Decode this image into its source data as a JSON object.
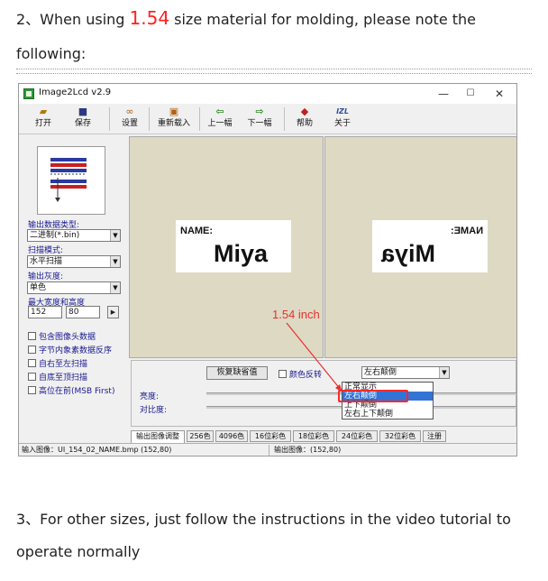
{
  "doc": {
    "line1_prefix": "2、When using ",
    "line1_highlight": "1.54",
    "line1_suffix": " size material for molding, please note the",
    "line2": "following:",
    "line3": "3、For other sizes, just follow the instructions in the video tutorial to",
    "line4": "operate normally"
  },
  "window": {
    "title": "Image2Lcd v2.9",
    "controls": {
      "minimize": "—",
      "maximize": "☐",
      "close": "✕"
    }
  },
  "toolbar": {
    "items": [
      {
        "label": "打开",
        "icon": "open-folder-icon",
        "glyph": "📂"
      },
      {
        "label": "保存",
        "icon": "save-disk-icon",
        "glyph": "💾"
      },
      {
        "label": "设置",
        "icon": "glasses-settings-icon",
        "glyph": "👓"
      },
      {
        "label": "重新载入",
        "icon": "reload-icon",
        "glyph": "🔄"
      },
      {
        "label": "上一幅",
        "icon": "arrow-left-icon",
        "glyph": "⬅"
      },
      {
        "label": "下一幅",
        "icon": "arrow-right-icon",
        "glyph": "➡"
      },
      {
        "label": "帮助",
        "icon": "help-icon",
        "glyph": "◆"
      },
      {
        "label": "关于",
        "icon": "about-logo-icon",
        "glyph": "IZL"
      }
    ]
  },
  "left": {
    "output_type_label": "输出数据类型:",
    "output_type_value": "二进制(*.bin)",
    "scan_mode_label": "扫描模式:",
    "scan_mode_value": "水平扫描",
    "gray_label": "输出灰度:",
    "gray_value": "单色",
    "max_size_label": "最大宽度和高度",
    "max_width": "152",
    "max_height": "80",
    "checkboxes": [
      "包含图像头数据",
      "字节内象素数据反序",
      "自右至左扫描",
      "自底至顶扫描",
      "高位在前(MSB First)"
    ]
  },
  "canvas": {
    "left_small": "NAME:",
    "left_big": "Miya",
    "right_small": "NAME:",
    "right_big": "Miya"
  },
  "bottom": {
    "restore_button": "恢复缺省值",
    "invert_label": "颜色反转",
    "flip_combo_value": "左右颠倒",
    "brightness_label": "亮度:",
    "contrast_label": "对比度:",
    "flip_options": [
      "正常显示",
      "左右颠倒",
      "上下颠倒",
      "左右上下颠倒"
    ],
    "flip_selected": "左右颠倒"
  },
  "tabs": [
    "输出图像调整",
    "256色",
    "4096色",
    "16位彩色",
    "18位彩色",
    "24位彩色",
    "32位彩色",
    "注册"
  ],
  "status": {
    "input": "输入图像：UI_154_02_NAME.bmp (152,80)",
    "output": "输出图像：(152,80)"
  },
  "annotation": {
    "text": "1.54 inch",
    "color": "#e83030"
  },
  "colors": {
    "accent_red": "#ff2020",
    "canvas_bg": "#ddd9c3",
    "selection_blue": "#3373d6"
  }
}
